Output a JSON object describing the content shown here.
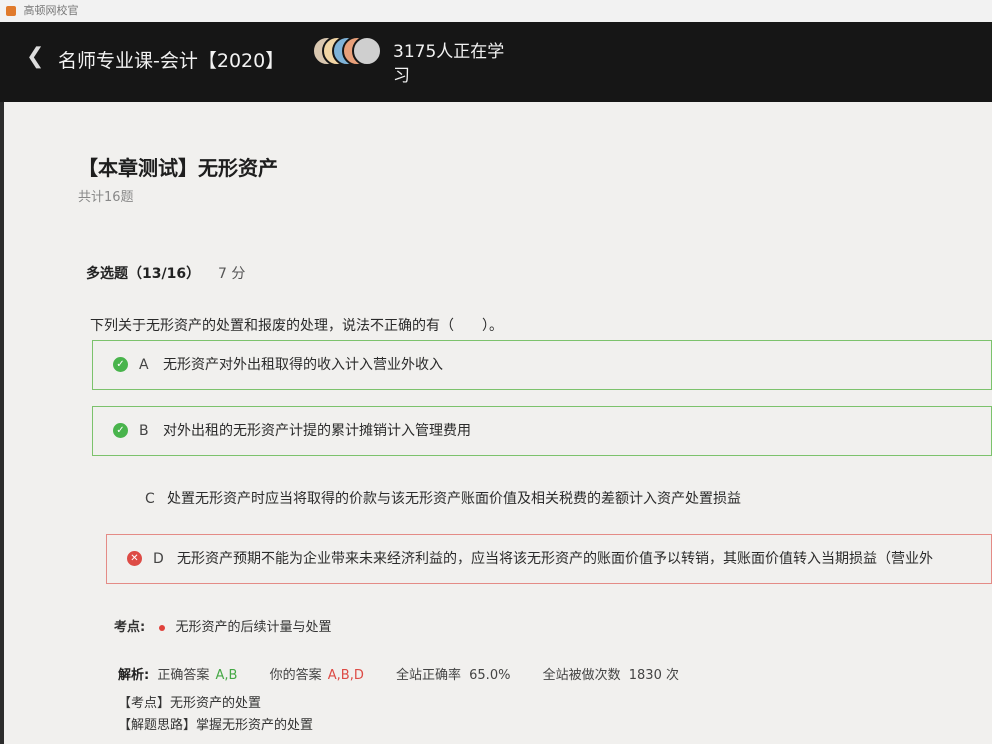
{
  "os": {
    "window_title": "高顿网校官"
  },
  "header": {
    "course_title": "名师专业课-会计【2020】",
    "learners_text": "3175人正在学习",
    "avatar_colors": [
      "#d9c7b0",
      "#f2d6a5",
      "#7fb3d8",
      "#e8a07a",
      "#cfcfcf"
    ]
  },
  "exam": {
    "title": "【本章测试】无形资产",
    "count": "共计16题"
  },
  "question": {
    "type": "多选题（13/16）",
    "score": "7 分",
    "stem": "下列关于无形资产的处置和报废的处理，说法不正确的有（　　）。",
    "options": [
      {
        "letter": "A",
        "text": "无形资产对外出租取得的收入计入营业外收入",
        "state": "correct",
        "icon": "check-icon"
      },
      {
        "letter": "B",
        "text": "对外出租的无形资产计提的累计摊销计入管理费用",
        "state": "correct",
        "icon": "check-icon"
      },
      {
        "letter": "C",
        "text": "处置无形资产时应当将取得的价款与该无形资产账面价值及相关税费的差额计入资产处置损益",
        "state": "plain",
        "icon": ""
      },
      {
        "letter": "D",
        "text": "无形资产预期不能为企业带来未来经济利益的，应当将该无形资产的账面价值予以转销，其账面价值转入当期损益（营业外",
        "state": "wrong",
        "icon": "cross-icon"
      }
    ]
  },
  "knowledge": {
    "label": "考点:",
    "item": "无形资产的后续计量与处置"
  },
  "analysis": {
    "label": "解析:",
    "correct_label": "正确答案",
    "correct_value": "A,B",
    "yours_label": "你的答案",
    "yours_value": "A,B,D",
    "rate_label": "全站正确率",
    "rate_value": "65.0%",
    "times_label": "全站被做次数",
    "times_value": "1830 次",
    "line1": "【考点】无形资产的处置",
    "line2": "【解题思路】掌握无形资产的处置"
  },
  "colors": {
    "correct_green": "#49b44c",
    "wrong_red": "#dd4b45",
    "header_bg": "#161616"
  }
}
